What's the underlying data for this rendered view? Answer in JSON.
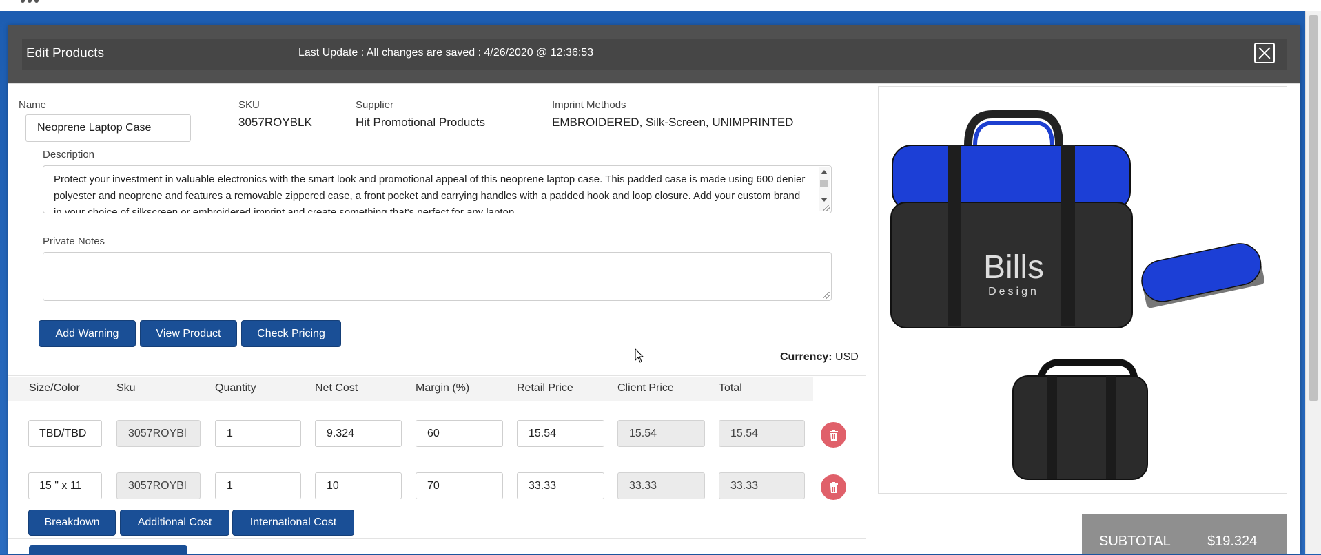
{
  "modal": {
    "title": "Edit Products",
    "last_update": "Last Update : All changes are saved : 4/26/2020 @ 12:36:53"
  },
  "product": {
    "name_label": "Name",
    "name_value": "Neoprene Laptop Case",
    "sku_label": "SKU",
    "sku_value": "3057ROYBLK",
    "supplier_label": "Supplier",
    "supplier_value": "Hit Promotional Products",
    "imprint_label": "Imprint Methods",
    "imprint_value": "EMBROIDERED, Silk-Screen, UNIMPRINTED",
    "description_label": "Description",
    "description_value": "Protect your investment in valuable electronics with the smart look and promotional appeal of this neoprene laptop case. This padded case is made using 600 denier polyester and neoprene and features a removable zippered case, a front pocket and carrying handles with a padded hook and loop closure. Add your custom brand in your choice of silkscreen or embroidered imprint and create something that's perfect for any laptop",
    "notes_label": "Private Notes",
    "notes_value": ""
  },
  "actions": {
    "add_warning": "Add Warning",
    "view_product": "View Product",
    "check_pricing": "Check Pricing"
  },
  "currency": {
    "label": "Currency:",
    "value": "USD"
  },
  "table": {
    "headers": [
      "Size/Color",
      "Sku",
      "Quantity",
      "Net Cost",
      "Margin (%)",
      "Retail Price",
      "Client Price",
      "Total"
    ],
    "rows": [
      [
        "TBD/TBD",
        "3057ROYBl",
        "1",
        "9.324",
        "60",
        "15.54",
        "15.54",
        "15.54"
      ],
      [
        "15 \" x 11",
        "3057ROYBl",
        "1",
        "10",
        "70",
        "33.33",
        "33.33",
        "33.33"
      ]
    ]
  },
  "bottom_actions": {
    "breakdown": "Breakdown",
    "additional_cost": "Additional Cost",
    "international_cost": "International Cost"
  },
  "image": {
    "logo_line1": "Bills",
    "logo_line2": "Design"
  },
  "subtotal": {
    "label": "SUBTOTAL",
    "value": "$19.324"
  },
  "icons": [
    "apps-grid-icon",
    "close-icon",
    "trash-icon",
    "scroll-up-icon",
    "scroll-down-icon",
    "mouse-cursor-icon"
  ],
  "colors": {
    "primary_button": "#1a4f96",
    "danger": "#e0606a",
    "header": "#505050",
    "page_bg": "#1f5fb0"
  }
}
